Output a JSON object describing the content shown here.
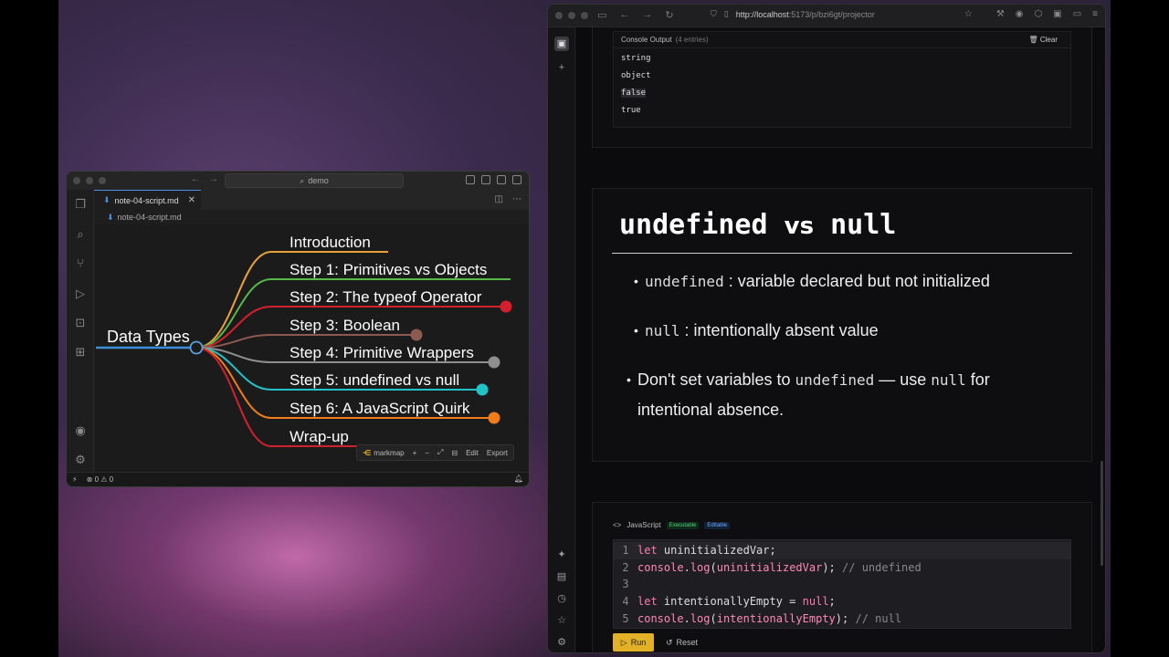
{
  "vscode": {
    "search": "demo",
    "tab_label": "note-04-script.md",
    "tab_close": "✕",
    "breadcrumb": "note-04-script.md",
    "status_errors": "0",
    "status_warnings": "0",
    "markmap": {
      "root": "Data Types",
      "branches": [
        {
          "label": "Introduction",
          "color": "#e8a13c"
        },
        {
          "label": "Step 1: Primitives vs Objects",
          "color": "#58b849"
        },
        {
          "label": "Step 2: The typeof Operator",
          "color": "#d2202f"
        },
        {
          "label": "Step 3: Boolean",
          "color": "#8d5a52"
        },
        {
          "label": "Step 4: Primitive Wrappers",
          "color": "#8f8f8f"
        },
        {
          "label": "Step 5: undefined vs null",
          "color": "#22c3c7"
        },
        {
          "label": "Step 6: A JavaScript Quirk",
          "color": "#f07c1a"
        },
        {
          "label": "Wrap-up",
          "color": "#d2202f"
        }
      ],
      "toolbar": {
        "brand": "markmap",
        "edit": "Edit",
        "export": "Export"
      }
    }
  },
  "browser": {
    "url_host": "http://localhost",
    "url_path": ":5173/p/bzi6gt/projector",
    "console": {
      "title": "Console Output",
      "count": "(4 entries)",
      "clear": "Clear",
      "lines": [
        "string",
        "object",
        "false",
        "true"
      ]
    },
    "slide": {
      "title_a": "undefined",
      "title_vs": "vs",
      "title_b": "null",
      "b1_code": "undefined",
      "b1_text": ": variable declared but not initialized",
      "b2_code": "null",
      "b2_text": ": intentionally absent value",
      "b3_pre": "Don't set variables to ",
      "b3_code1": "undefined",
      "b3_mid": " — use ",
      "b3_code2": "null",
      "b3_post": " for intentional absence."
    },
    "code": {
      "lang": "JavaScript",
      "badge_exec": "Executable",
      "badge_edit": "Editable",
      "lines": [
        "1",
        "2",
        "3",
        "4",
        "5"
      ],
      "run": "Run",
      "reset": "Reset"
    }
  }
}
